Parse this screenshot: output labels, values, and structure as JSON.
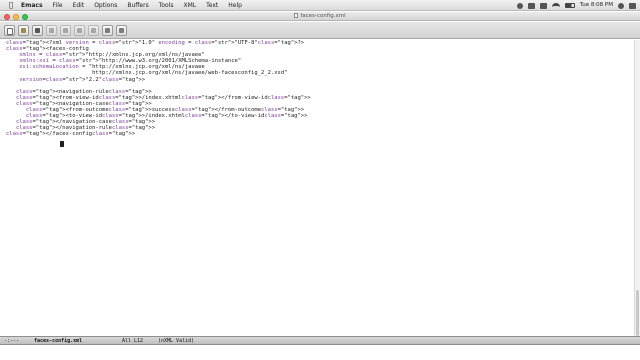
{
  "menubar": {
    "app_name": "Emacs",
    "items": [
      "File",
      "Edit",
      "Options",
      "Buffers",
      "Tools",
      "XML",
      "Text",
      "Help"
    ],
    "clock": "Tue 8:08 PM"
  },
  "window": {
    "title": "faces-config.xml"
  },
  "toolbar": {
    "buttons": [
      "new-file",
      "open-file",
      "save",
      "undo",
      "cut",
      "copy",
      "paste",
      "search",
      "preferences"
    ]
  },
  "editor": {
    "lines": [
      "<?xml version = \"1.0\" encoding = \"UTF-8\"?>",
      "<faces-config",
      "    xmlns = \"http://xmlns.jcp.org/xml/ns/javaee\"",
      "    xmlns:xsi = \"http://www.w3.org/2001/XMLSchema-instance\"",
      "    xsi:schemaLocation = \"http://xmlns.jcp.org/xml/ns/javaee",
      "                          http://xmlns.jcp.org/xml/ns/javaee/web-facesconfig_2_2.xsd\"",
      "    version=\"2.2\">",
      "",
      "   <navigation-rule>",
      "   <from-view-id>/index.xhtml</from-view-id>",
      "   <navigation-case>",
      "      <from-outcome>success</from-outcome>",
      "      <to-view-id>/index.xhtml</to-view-id>",
      "   </navigation-case>",
      "   </navigation-rule>",
      "</faces-config>"
    ]
  },
  "modeline": {
    "status": "-:---",
    "buffer": "faces-config.xml",
    "position": "All L12",
    "mode": "(nXML Valid)"
  },
  "colors": {
    "tag": "#1c2fb8",
    "attribute": "#7d3c98",
    "string": "#a9672a"
  }
}
